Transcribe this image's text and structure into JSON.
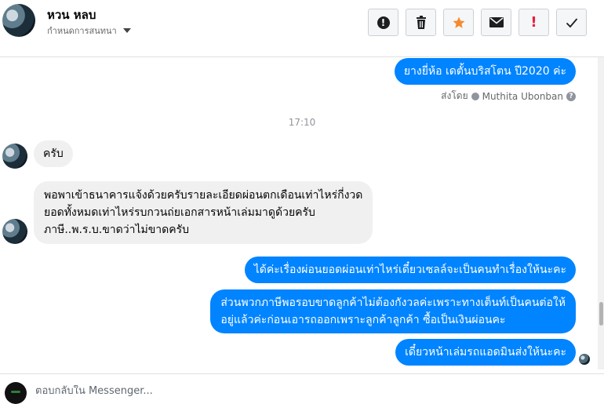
{
  "header": {
    "contact_name": "หวน หลบ",
    "settings_label": "กำหนดการสนทนา",
    "actions": [
      {
        "name": "spam-button",
        "icon": "alert-circle-icon"
      },
      {
        "name": "delete-button",
        "icon": "trash-icon"
      },
      {
        "name": "star-button",
        "icon": "star-icon",
        "color": "#f68a2c"
      },
      {
        "name": "unread-button",
        "icon": "envelope-icon"
      },
      {
        "name": "follow-up-button",
        "icon": "exclamation-icon",
        "color": "#e41e3f"
      },
      {
        "name": "done-button",
        "icon": "checkmark-icon"
      }
    ]
  },
  "thread": {
    "messages": [
      {
        "direction": "out",
        "text": "ยางยี่ห้อ เดตั้นบริสโตน ปี2020 ค่ะ"
      },
      {
        "direction": "in",
        "text": "ครับ"
      },
      {
        "direction": "in",
        "lines": [
          "พอพาเข้าธนาคารแจ้งด้วยครับรายละเอียดผ่อนตกเดือนเท่าไหร่กี่งวด",
          "ยอดทั้งหมดเท่าไหร่รบกวนถ่ยเอกสารหน้าเล่มมาดูด้วยครับ",
          "ภาษี..พ.ร.บ.ขาดว่าไม่ขาดครับ"
        ]
      },
      {
        "direction": "out",
        "text": "ได้ค่ะเรื่องผ่อนยอดผ่อนเท่าไหร่เดี๋ยวเซลล์จะเป็นคนทำเรื่องให้นะคะ"
      },
      {
        "direction": "out",
        "lines": [
          "ส่วนพวกภาษีพอรอบขาดลูกค้าไม่ต้องกังวลค่ะเพราะทางเต็นท์เป็นคนต่อให้",
          "อยู่แล้วค่ะก่อนเอารถออกเพราะลูกค้าลูกค้า ซื้อเป็นเงินผ่อนคะ"
        ]
      },
      {
        "direction": "out",
        "text": "เดี๋ยวหน้าเล่มรถแอดมินส่งให้นะคะ"
      }
    ],
    "sent_by_prefix": "ส่งโดย",
    "sent_by_name": "Muthita Ubonban",
    "timestamp": "17:10"
  },
  "composer": {
    "placeholder": "ตอบกลับใน Messenger..."
  },
  "colors": {
    "outgoing_bubble": "#0084ff",
    "incoming_bubble": "#f1f0f0",
    "accent_star": "#f68a2c",
    "accent_red": "#e41e3f"
  }
}
